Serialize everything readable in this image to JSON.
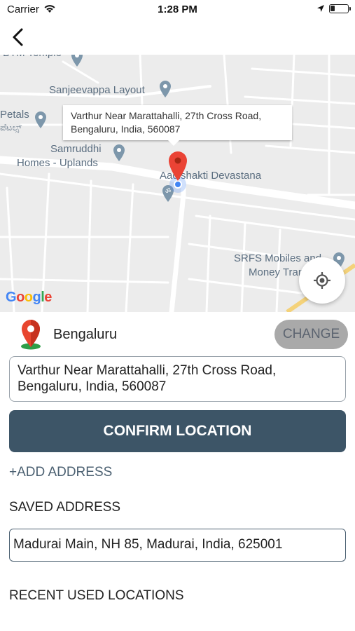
{
  "status_bar": {
    "carrier": "Carrier",
    "time": "1:28 PM"
  },
  "nav": {
    "back_icon": "chevron-left-icon"
  },
  "map": {
    "labels": {
      "top_partial": "BTM Temple",
      "sanjeevappa": "Sanjeevappa Layout",
      "petals": "Petals",
      "petals_kannada": "ಪೆಟಲ್ಸ್",
      "samruddhi_1": "Samruddhi",
      "samruddhi_2": "Homes - Uplands",
      "aadishakti": "Aadishakti Devastana",
      "srfs_1": "SRFS Mobiles and",
      "srfs_2": "Money Transfer"
    },
    "callout_line1": "Varthur Near Marattahalli, 27th Cross Road,",
    "callout_line2": "Bengaluru, India, 560087",
    "google_logo": "Google",
    "marker_color": "#ea4335",
    "location_dot_color": "#4285f4"
  },
  "location": {
    "city": "Bengaluru",
    "change_label": "CHANGE",
    "address_line1": "Varthur Near Marattahalli, 27th Cross Road,",
    "address_line2": "Bengaluru, India, 560087",
    "confirm_label": "CONFIRM LOCATION",
    "add_address_label": "+ADD ADDRESS"
  },
  "saved": {
    "heading": "SAVED ADDRESS",
    "address": "Madurai Main, NH 85, Madurai, India, 625001"
  },
  "recent": {
    "heading": "RECENT USED LOCATIONS"
  },
  "colors": {
    "primary": "#3d5567",
    "change_bg": "#a9a9a9",
    "link": "#4c6172"
  }
}
